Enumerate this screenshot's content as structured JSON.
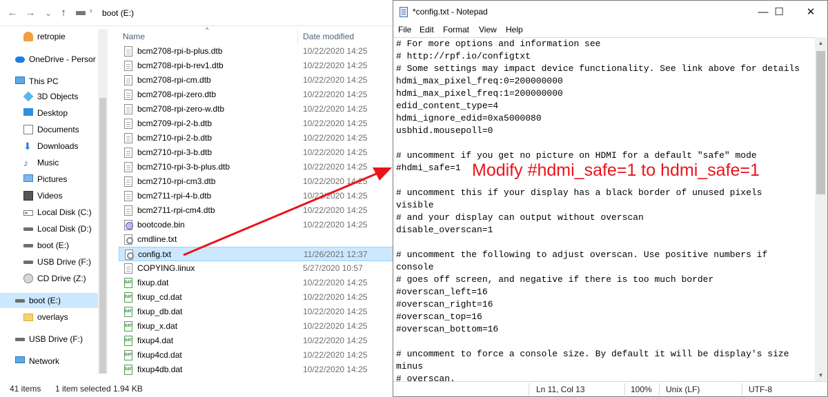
{
  "explorer": {
    "address": {
      "location": "boot (E:)",
      "separator": "›"
    },
    "nav_buttons": {
      "back": "←",
      "forward": "→",
      "recent": "⌄",
      "up": "↑"
    },
    "nav": [
      {
        "label": "retropie",
        "icon": "user-folder-icon"
      },
      {
        "label": "OneDrive - Persor",
        "icon": "cloud-icon"
      },
      {
        "label": "This PC",
        "icon": "pc-icon"
      },
      {
        "label": "3D Objects",
        "icon": "cube-icon"
      },
      {
        "label": "Desktop",
        "icon": "desktop-icon"
      },
      {
        "label": "Documents",
        "icon": "documents-icon"
      },
      {
        "label": "Downloads",
        "icon": "download-arrow-icon"
      },
      {
        "label": "Music",
        "icon": "music-note-icon"
      },
      {
        "label": "Pictures",
        "icon": "pictures-icon"
      },
      {
        "label": "Videos",
        "icon": "film-icon"
      },
      {
        "label": "Local Disk (C:)",
        "icon": "disk-icon"
      },
      {
        "label": "Local Disk (D:)",
        "icon": "drive-icon"
      },
      {
        "label": "boot (E:)",
        "icon": "drive-icon"
      },
      {
        "label": "USB Drive (F:)",
        "icon": "drive-icon"
      },
      {
        "label": "CD Drive (Z:)",
        "icon": "cd-icon"
      },
      {
        "label": "boot (E:)",
        "icon": "drive-icon"
      },
      {
        "label": "overlays",
        "icon": "folder-icon"
      },
      {
        "label": "USB Drive (F:)",
        "icon": "drive-icon"
      },
      {
        "label": "Network",
        "icon": "network-icon"
      }
    ],
    "columns": {
      "name": "Name",
      "date": "Date modified",
      "sort_glyph": "^"
    },
    "files": [
      {
        "name": "bcm2708-rpi-b-plus.dtb",
        "date": "10/22/2020 14:25",
        "type": "doc"
      },
      {
        "name": "bcm2708-rpi-b-rev1.dtb",
        "date": "10/22/2020 14:25",
        "type": "doc"
      },
      {
        "name": "bcm2708-rpi-cm.dtb",
        "date": "10/22/2020 14:25",
        "type": "doc"
      },
      {
        "name": "bcm2708-rpi-zero.dtb",
        "date": "10/22/2020 14:25",
        "type": "doc"
      },
      {
        "name": "bcm2708-rpi-zero-w.dtb",
        "date": "10/22/2020 14:25",
        "type": "doc"
      },
      {
        "name": "bcm2709-rpi-2-b.dtb",
        "date": "10/22/2020 14:25",
        "type": "doc"
      },
      {
        "name": "bcm2710-rpi-2-b.dtb",
        "date": "10/22/2020 14:25",
        "type": "doc"
      },
      {
        "name": "bcm2710-rpi-3-b.dtb",
        "date": "10/22/2020 14:25",
        "type": "doc"
      },
      {
        "name": "bcm2710-rpi-3-b-plus.dtb",
        "date": "10/22/2020 14:25",
        "type": "doc"
      },
      {
        "name": "bcm2710-rpi-cm3.dtb",
        "date": "10/22/2020 14:25",
        "type": "doc"
      },
      {
        "name": "bcm2711-rpi-4-b.dtb",
        "date": "10/22/2020 14:25",
        "type": "doc"
      },
      {
        "name": "bcm2711-rpi-cm4.dtb",
        "date": "10/22/2020 14:25",
        "type": "doc"
      },
      {
        "name": "bootcode.bin",
        "date": "10/22/2020 14:25",
        "type": "bin"
      },
      {
        "name": "cmdline.txt",
        "date": "",
        "type": "gear"
      },
      {
        "name": "config.txt",
        "date": "11/26/2021 12:37",
        "type": "gear",
        "selected": true
      },
      {
        "name": "COPYING.linux",
        "date": "5/27/2020 10:57",
        "type": "doc"
      },
      {
        "name": "fixup.dat",
        "date": "10/22/2020 14:25",
        "type": "dat"
      },
      {
        "name": "fixup_cd.dat",
        "date": "10/22/2020 14:25",
        "type": "dat"
      },
      {
        "name": "fixup_db.dat",
        "date": "10/22/2020 14:25",
        "type": "dat"
      },
      {
        "name": "fixup_x.dat",
        "date": "10/22/2020 14:25",
        "type": "dat"
      },
      {
        "name": "fixup4.dat",
        "date": "10/22/2020 14:25",
        "type": "dat"
      },
      {
        "name": "fixup4cd.dat",
        "date": "10/22/2020 14:25",
        "type": "dat"
      },
      {
        "name": "fixup4db.dat",
        "date": "10/22/2020 14:25",
        "type": "dat"
      }
    ],
    "status": {
      "count": "41 items",
      "selection": "1 item selected",
      "size": "1.94 KB"
    }
  },
  "notepad": {
    "title": "*config.txt - Notepad",
    "window_controls": {
      "minimize": "—",
      "maximize": "☐",
      "close": "✕"
    },
    "menu": [
      "File",
      "Edit",
      "Format",
      "View",
      "Help"
    ],
    "lines": [
      "# For more options and information see",
      "# http://rpf.io/configtxt",
      "# Some settings may impact device functionality. See link above for details",
      "hdmi_max_pixel_freq:0=200000000",
      "hdmi_max_pixel_freq:1=200000000",
      "edid_content_type=4",
      "hdmi_ignore_edid=0xa5000080",
      "usbhid.mousepoll=0",
      "",
      "# uncomment if you get no picture on HDMI for a default \"safe\" mode",
      "#hdmi_safe=1",
      "",
      "# uncomment this if your display has a black border of unused pixels",
      "visible",
      "# and your display can output without overscan",
      "disable_overscan=1",
      "",
      "# uncomment the following to adjust overscan. Use positive numbers if",
      "console",
      "# goes off screen, and negative if there is too much border",
      "#overscan_left=16",
      "#overscan_right=16",
      "#overscan_top=16",
      "#overscan_bottom=16",
      "",
      "# uncomment to force a console size. By default it will be display's size",
      "minus",
      "# overscan."
    ],
    "status": {
      "position": "Ln 11, Col 13",
      "zoom": "100%",
      "line_ending": "Unix (LF)",
      "encoding": "UTF-8"
    }
  },
  "annotation": {
    "text": "Modify #hdmi_safe=1 to hdmi_safe=1",
    "color": "#e8141c"
  },
  "colors": {
    "selection": "#cce8ff",
    "accent_blue": "#2f7fe0"
  }
}
